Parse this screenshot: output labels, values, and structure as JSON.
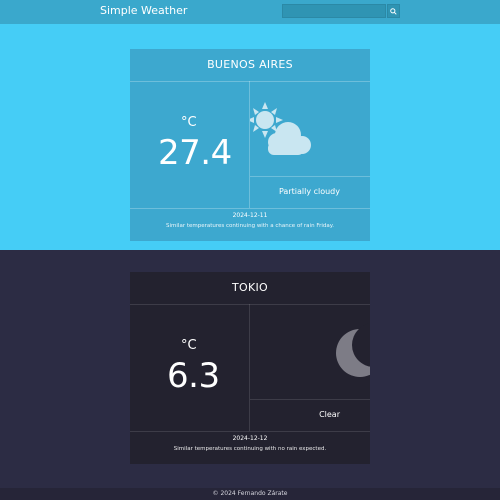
{
  "app": {
    "title": "Simple Weather",
    "search": {
      "placeholder": "",
      "value": ""
    },
    "search_button_icon": "search-icon"
  },
  "cities": [
    {
      "name": "BUENOS AIRES",
      "unit": "°C",
      "temp": "27.4",
      "condition": "Partially cloudy",
      "icon": "partly-cloudy-icon",
      "date": "2024-12-11",
      "description": "Similar temperatures continuing with a chance of rain Friday.",
      "theme": "day",
      "bg": "#45cdf6",
      "card": "#3da8cf"
    },
    {
      "name": "TOKIO",
      "unit": "°C",
      "temp": "6.3",
      "condition": "Clear",
      "icon": "moon-icon",
      "date": "2024-12-12",
      "description": "Similar temperatures continuing with no rain expected.",
      "theme": "night",
      "bg": "#2c2c44",
      "card": "#23222f"
    }
  ],
  "footer": {
    "text": "© 2024 Fernando Zárate"
  }
}
